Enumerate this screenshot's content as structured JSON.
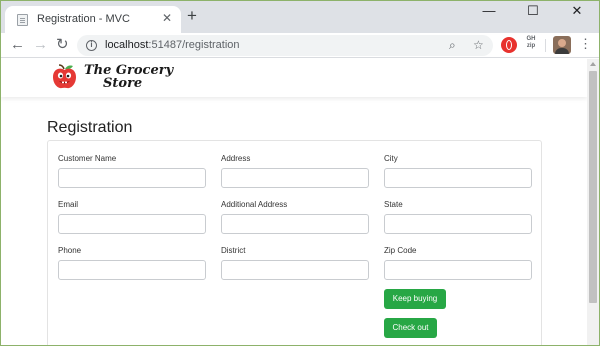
{
  "browser": {
    "tab_title": "Registration - MVC",
    "tab_close": "✕",
    "new_tab": "+",
    "window_controls": {
      "minimize": "—",
      "maximize": "☐",
      "close": "✕"
    },
    "nav": {
      "back": "←",
      "forward": "→",
      "reload": "↻"
    },
    "url_host": "localhost",
    "url_rest": ":51487/registration",
    "zoom_icon": "⌕",
    "bookmark_icon": "☆",
    "extension_gh_text": "GH zip",
    "menu_icon": "⋮"
  },
  "site": {
    "logo_line1": "The Grocery",
    "logo_line2": "Store"
  },
  "page": {
    "title": "Registration"
  },
  "form": {
    "fields": {
      "customer_name": {
        "label": "Customer Name",
        "value": ""
      },
      "email": {
        "label": "Email",
        "value": ""
      },
      "phone": {
        "label": "Phone",
        "value": ""
      },
      "address": {
        "label": "Address",
        "value": ""
      },
      "additional_address": {
        "label": "Additional Address",
        "value": ""
      },
      "district": {
        "label": "District",
        "value": ""
      },
      "city": {
        "label": "City",
        "value": ""
      },
      "state": {
        "label": "State",
        "value": ""
      },
      "zip_code": {
        "label": "Zip Code",
        "value": ""
      }
    },
    "keep_buying_label": "Keep buying",
    "check_out_label": "Check out",
    "button_color": "#27a745"
  }
}
